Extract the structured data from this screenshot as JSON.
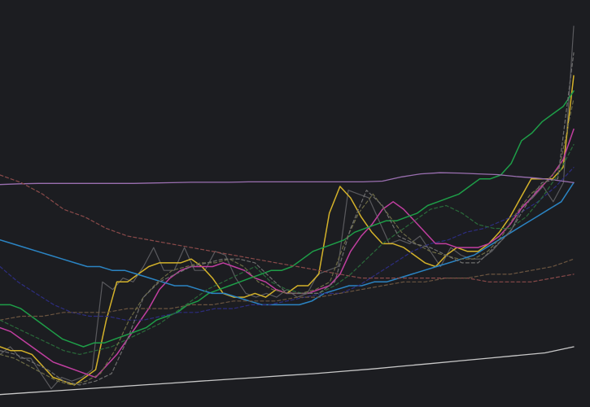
{
  "chart_data": {
    "type": "line",
    "title": "",
    "xlabel": "",
    "ylabel": "",
    "grid": false,
    "legend": "none",
    "xlim": [
      0,
      64
    ],
    "ylim": [
      0,
      100
    ],
    "background": "#1c1d21",
    "series": [
      {
        "color": "#5a5a5e",
        "width": 1.2,
        "dash": "",
        "values": [
          11,
          13,
          10,
          10,
          6,
          2,
          5,
          4,
          5,
          7,
          30,
          28,
          31,
          30,
          34,
          39,
          33,
          33,
          39,
          33,
          33,
          38,
          37,
          31,
          27,
          26,
          27,
          26,
          28,
          26,
          27,
          32,
          33,
          34,
          54,
          53,
          52,
          46,
          40,
          41,
          40,
          42,
          38,
          34,
          39,
          37,
          36,
          36,
          38,
          41,
          44,
          50,
          52,
          55,
          51,
          56,
          97
        ]
      },
      {
        "color": "#d4b22a",
        "width": 1.5,
        "dash": "",
        "values": [
          13,
          12,
          12,
          11,
          8,
          5,
          4,
          3,
          5,
          7,
          20,
          30,
          30,
          32,
          34,
          35,
          35,
          35,
          36,
          34,
          31,
          27,
          26,
          26,
          27,
          26,
          28,
          27,
          29,
          29,
          32,
          48,
          55,
          52,
          47,
          43,
          40,
          40,
          39,
          37,
          35,
          34,
          37,
          39,
          38,
          38,
          40,
          43,
          47,
          52,
          57,
          57,
          57,
          60,
          84
        ]
      },
      {
        "color": "#c13fa0",
        "width": 1.5,
        "dash": "",
        "values": [
          18,
          17,
          15,
          13,
          11,
          9,
          8,
          7,
          6,
          5,
          8,
          11,
          15,
          19,
          23,
          28,
          31,
          33,
          34,
          34,
          34,
          35,
          34,
          33,
          31,
          30,
          28,
          27,
          27,
          27,
          28,
          29,
          32,
          38,
          42,
          45,
          49,
          51,
          49,
          46,
          43,
          40,
          40,
          39,
          39,
          39,
          40,
          42,
          45,
          49,
          52,
          55,
          58,
          62,
          70
        ]
      },
      {
        "color": "#1e9e48",
        "width": 1.5,
        "dash": "",
        "values": [
          24,
          24,
          23,
          21,
          19,
          17,
          15,
          14,
          13,
          14,
          14,
          15,
          16,
          17,
          18,
          20,
          21,
          22,
          24,
          25,
          27,
          28,
          29,
          30,
          31,
          32,
          33,
          33,
          34,
          36,
          38,
          39,
          40,
          41,
          43,
          44,
          45,
          46,
          46,
          47,
          48,
          50,
          51,
          52,
          53,
          55,
          57,
          57,
          58,
          61,
          67,
          69,
          72,
          74,
          76,
          80
        ]
      },
      {
        "color": "#2b84c3",
        "width": 1.5,
        "dash": "",
        "values": [
          41,
          40,
          39,
          38,
          37,
          36,
          35,
          34,
          34,
          33,
          33,
          32,
          31,
          30,
          29,
          29,
          28,
          27,
          27,
          26,
          25,
          24,
          24,
          24,
          24,
          25,
          27,
          28,
          29,
          29,
          30,
          30,
          31,
          32,
          33,
          34,
          35,
          36,
          37,
          39,
          41,
          43,
          45,
          47,
          49,
          51,
          56
        ]
      },
      {
        "color": "#9a6fb0",
        "width": 1.3,
        "dash": "",
        "values": [
          55.5,
          55.7,
          55.8,
          55.8,
          55.8,
          55.8,
          55.8,
          55.8,
          55.9,
          56.0,
          56.1,
          56.1,
          56.1,
          56.2,
          56.2,
          56.2,
          56.2,
          56.2,
          56.2,
          56.2,
          56.4,
          57.5,
          58.3,
          58.6,
          58.5,
          58.3,
          58.1,
          57.6,
          57.2,
          56.7,
          56.0
        ]
      },
      {
        "color": "#c8c8c8",
        "width": 1.3,
        "dash": "",
        "values": [
          0.5,
          1.0,
          1.5,
          2.0,
          2.5,
          3.0,
          3.5,
          4.0,
          4.5,
          5.0,
          5.5,
          6.0,
          6.6,
          7.2,
          7.9,
          8.6,
          9.3,
          10.0,
          10.7,
          11.4,
          13.0
        ]
      },
      {
        "color": "#8a4a4a",
        "width": 1.2,
        "dash": "4 3",
        "values": [
          58,
          56,
          53,
          49,
          47,
          44,
          42,
          41,
          40,
          39,
          38,
          37,
          36,
          35,
          34,
          33,
          32,
          31,
          31,
          31,
          31,
          31,
          31,
          30,
          30,
          30,
          31,
          32
        ]
      },
      {
        "color": "#2d2d80",
        "width": 1.2,
        "dash": "4 3",
        "values": [
          34,
          30,
          27,
          24,
          22,
          21,
          21,
          20,
          20,
          21,
          22,
          22,
          23,
          23,
          24,
          24,
          25,
          26,
          27,
          27,
          29,
          32,
          35,
          38,
          40,
          41,
          43,
          44,
          46,
          48,
          51,
          55,
          60
        ]
      },
      {
        "color": "#6b5540",
        "width": 1.2,
        "dash": "4 3",
        "values": [
          20,
          21,
          21,
          22,
          22,
          22,
          23,
          23,
          23,
          24,
          24,
          25,
          25,
          25,
          26,
          26,
          27,
          28,
          29,
          30,
          30,
          31,
          31,
          32,
          32,
          33,
          34,
          36
        ]
      },
      {
        "color": "#2a6a3a",
        "width": 1.2,
        "dash": "4 3",
        "values": [
          20,
          18,
          16,
          14,
          12,
          11,
          12,
          13,
          15,
          17,
          19,
          22,
          25,
          28,
          30,
          32,
          34,
          30,
          28,
          27,
          27,
          29,
          32,
          36,
          40,
          43,
          46,
          49,
          50,
          48,
          45,
          44,
          44,
          47,
          52,
          58,
          66
        ]
      },
      {
        "color": "#6d6b45",
        "width": 1.2,
        "dash": "4 3",
        "values": [
          11,
          10,
          8,
          6,
          4,
          3,
          4,
          6,
          12,
          20,
          26,
          30,
          33,
          34,
          35,
          35,
          36,
          34,
          30,
          28,
          27,
          27,
          28,
          30,
          40,
          48,
          53,
          48,
          43,
          40,
          38,
          37,
          36,
          36,
          38,
          42,
          48,
          53,
          56,
          60,
          78
        ]
      },
      {
        "color": "#6e6e6e",
        "width": 1.2,
        "dash": "4 3",
        "values": [
          12,
          11,
          9,
          7,
          4,
          3,
          4,
          6,
          15,
          26,
          30,
          32,
          34,
          35,
          36,
          36,
          35,
          31,
          27,
          27,
          27,
          30,
          44,
          54,
          50,
          42,
          40,
          39,
          37,
          35,
          35,
          39,
          43,
          50,
          56,
          57,
          90
        ]
      }
    ]
  }
}
